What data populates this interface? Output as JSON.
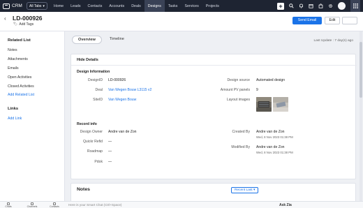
{
  "nav": {
    "app_name": "CRM",
    "all_tabs": "All Tabs",
    "links": [
      "Home",
      "Leads",
      "Contacts",
      "Accounts",
      "Deals",
      "Designs",
      "Tasks",
      "Services",
      "Projects"
    ],
    "active": "Designs"
  },
  "record": {
    "title": "LD-000926",
    "add_tags": "Add Tags",
    "send_email": "Send Email",
    "edit": "Edit"
  },
  "sidebar": {
    "related_list": "Related List",
    "items": [
      "Notes",
      "Attachments",
      "Emails",
      "Open Activities",
      "Closed Activities"
    ],
    "add_related": "Add Related List",
    "links_head": "Links",
    "add_link": "Add Link"
  },
  "tabs": {
    "overview": "Overview",
    "timeline": "Timeline"
  },
  "last_update": "Last Update : 7 day(s) ago",
  "details": {
    "hide": "Hide Details",
    "design_info": "Design Information",
    "designid_label": "DesignID",
    "designid": "LD-000926",
    "deal_label": "Deal",
    "deal": "Van Wegen Bouw L3115 v2",
    "siteid_label": "SiteID",
    "siteid": "Van Wegen Bouw",
    "source_label": "Design source",
    "source": "Automated design",
    "pv_label": "Amount PV panels",
    "pv": "9",
    "images_label": "Layout images"
  },
  "record_info": {
    "head": "Record info",
    "owner_label": "Design Owner",
    "owner": "Andre van de Zon",
    "quickrefid_label": "Quickr Refid",
    "quickrefid": "—",
    "roadmap_label": "Roadmap",
    "roadmap": "—",
    "pdok_label": "Pdok",
    "pdok": "—",
    "created_label": "Created By",
    "created_by": "Andre van de Zon",
    "created_at": "Wed, 8 Nov 2023 01:38 PM",
    "modified_label": "Modified By",
    "modified_by": "Andre van de Zon",
    "modified_at": "Wed, 8 Nov 2023 01:38 PM"
  },
  "notes": {
    "title": "Notes",
    "recent": "Recent Last"
  },
  "bottom": {
    "items": [
      "Chats",
      "Channels",
      "Contacts"
    ],
    "chat_placeholder": "Here is your Smart Chat (Ctrl+Space)",
    "ask_zia": "Ask Zia"
  },
  "colors": {
    "nav_bg": "#1e2432",
    "accent": "#1a73e8"
  }
}
